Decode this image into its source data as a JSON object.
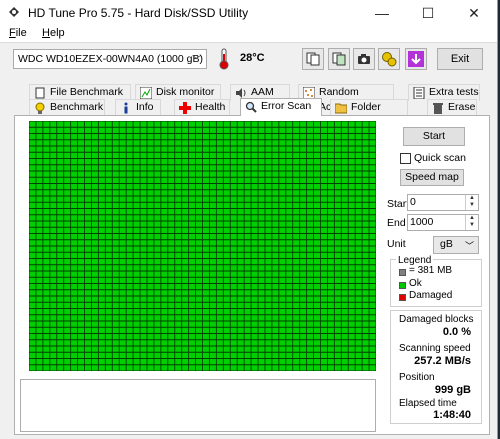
{
  "app": {
    "title": "HD Tune Pro 5.75 - Hard Disk/SSD Utility"
  },
  "window_controls": {
    "minimize": "—",
    "maximize": "☐",
    "close": "✕"
  },
  "menu": [
    {
      "label": "File",
      "mnemonic": "F",
      "rest": "ile"
    },
    {
      "label": "Help",
      "mnemonic": "H",
      "rest": "elp"
    }
  ],
  "toolbar": {
    "drive": "WDC WD10EZEX-00WN4A0 (1000 gB)",
    "temperature": "28°C",
    "exit_label": "Exit"
  },
  "tabs_top": [
    "File Benchmark",
    "Disk monitor",
    "AAM",
    "Random Access",
    "Extra tests"
  ],
  "tabs_bottom": [
    "Benchmark",
    "Info",
    "Health",
    "Error Scan",
    "Folder Usage",
    "Erase"
  ],
  "active_tab": "Error Scan",
  "controls": {
    "start_button": "Start",
    "quick_scan_label": "Quick scan",
    "quick_scan_checked": false,
    "speed_map_button": "Speed map",
    "start_label": "Start",
    "start_value": "0",
    "end_label": "End",
    "end_value": "1000",
    "unit_label": "Unit",
    "unit_value": "gB"
  },
  "legend": {
    "title": "Legend",
    "items": [
      {
        "label": "= 381 MB",
        "color": "#808080"
      },
      {
        "label": "Ok",
        "color": "#00c800"
      },
      {
        "label": "Damaged",
        "color": "#e00000"
      }
    ]
  },
  "stats": {
    "damaged_blocks_label": "Damaged blocks",
    "damaged_blocks_value": "0.0 %",
    "scanning_speed_label": "Scanning speed",
    "scanning_speed_value": "257.2 MB/s",
    "position_label": "Position",
    "position_value": "999 gB",
    "elapsed_label": "Elapsed time",
    "elapsed_value": "1:48:40"
  },
  "scan_grid": {
    "status": "all blocks ok",
    "ok_color": "#00d000",
    "line_color": "#004000"
  },
  "colors": {
    "accent": "#0078d7"
  }
}
